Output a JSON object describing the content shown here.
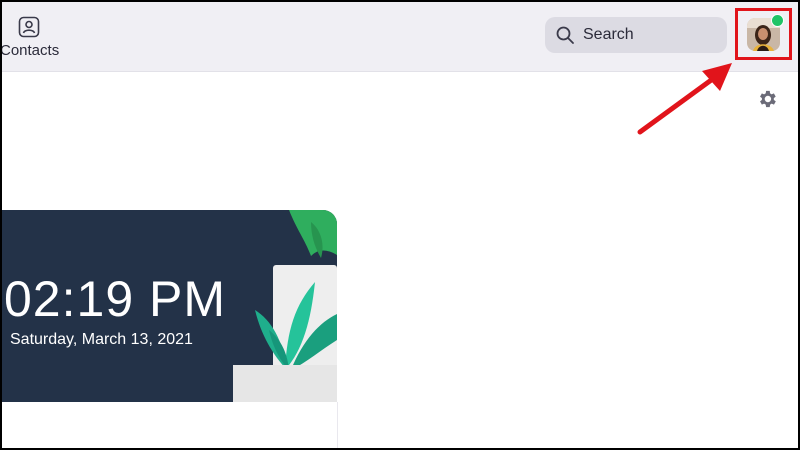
{
  "header": {
    "contacts_label": "Contacts",
    "search_label": "Search"
  },
  "clock_card": {
    "time": "02:19 PM",
    "date": "Saturday, March 13, 2021"
  },
  "colors": {
    "topbar_bg": "#f0eff4",
    "card_bg": "#233248",
    "highlight": "#e1141b",
    "presence": "#1fc466"
  },
  "icons": [
    "contacts-icon",
    "search-icon",
    "settings-gear-icon"
  ]
}
